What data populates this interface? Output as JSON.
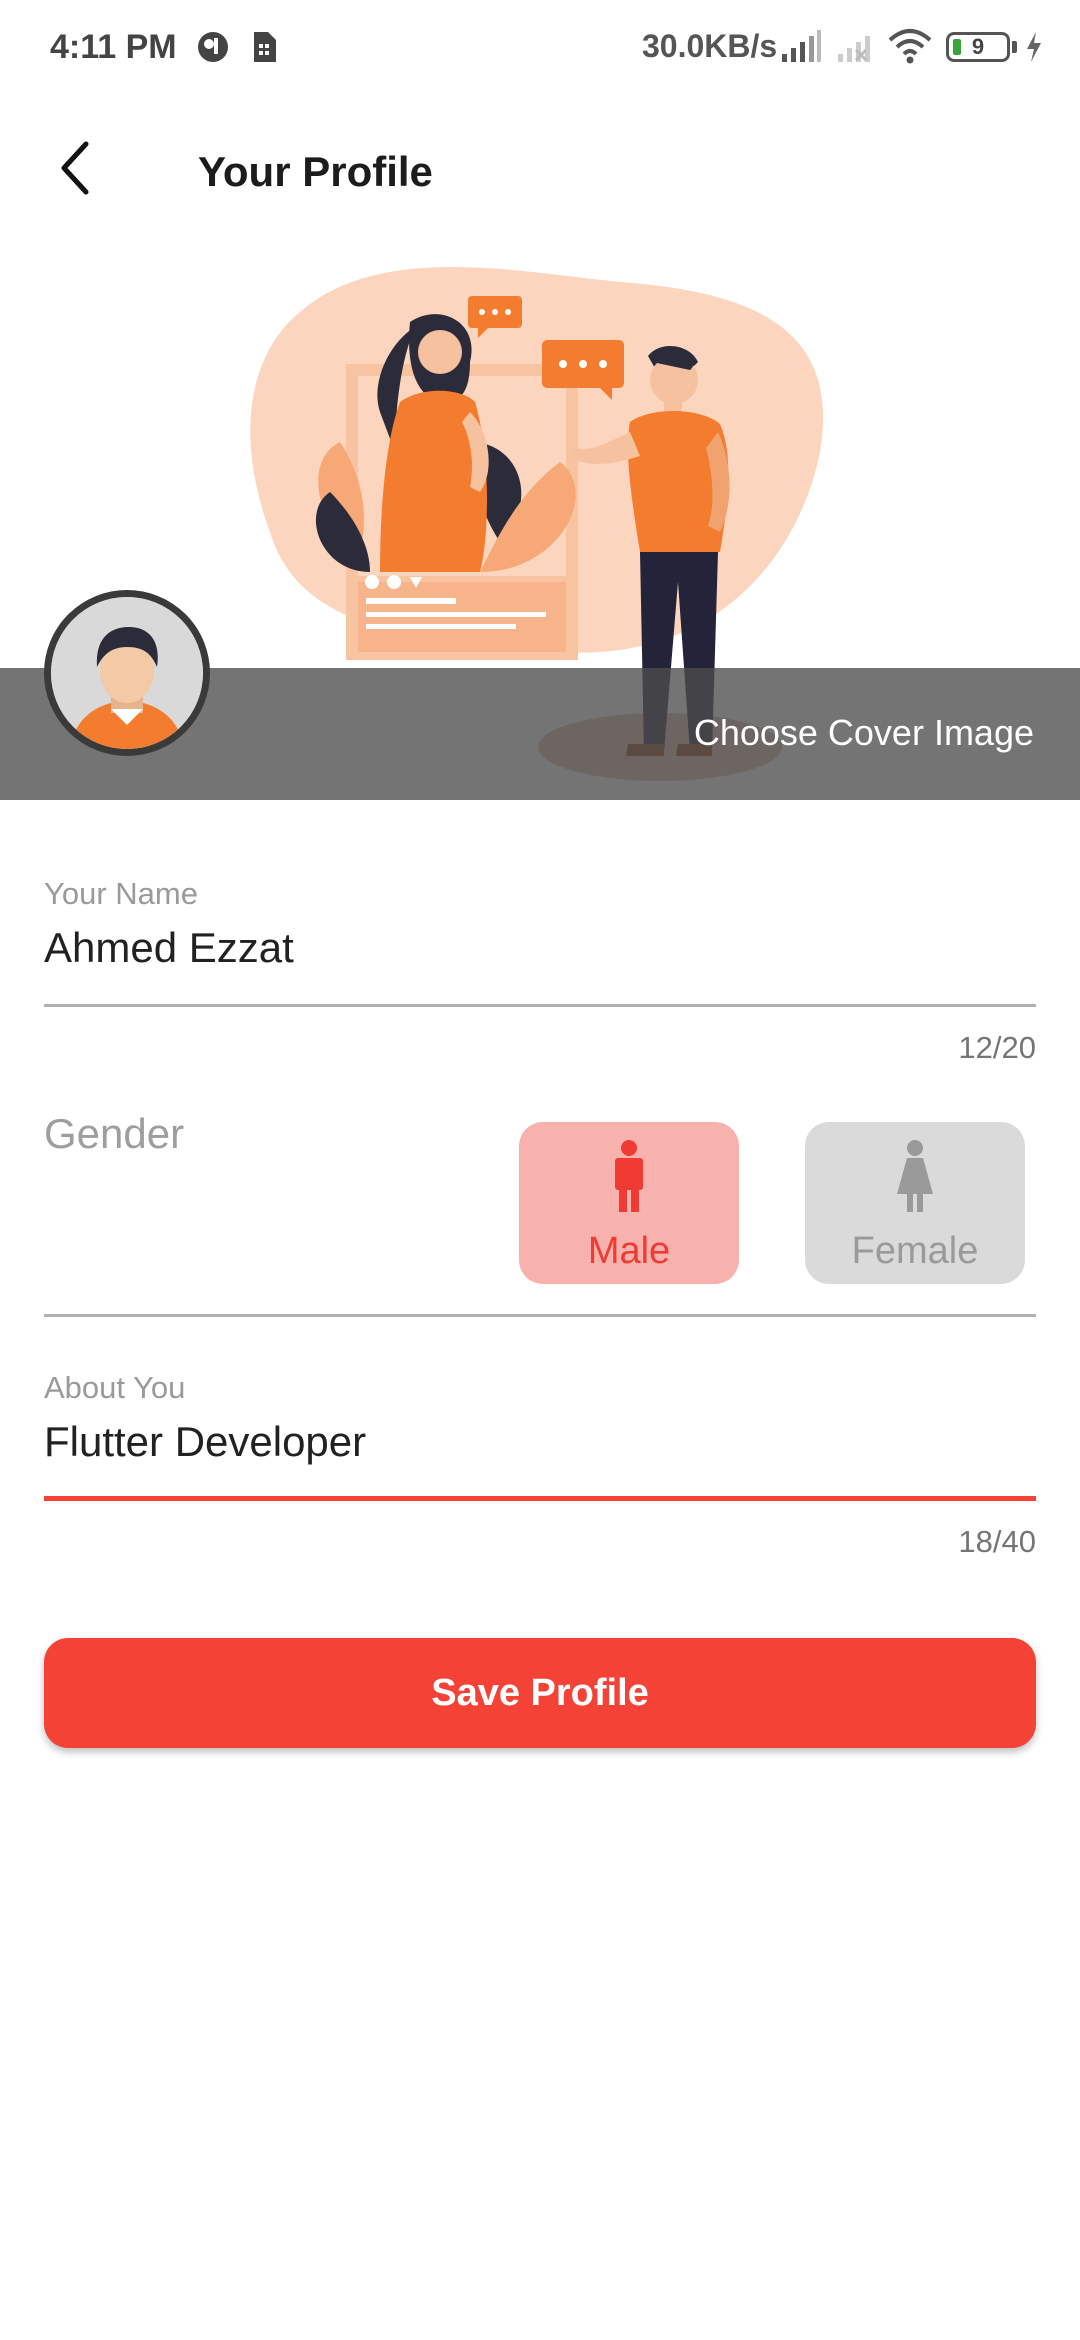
{
  "status_bar": {
    "time": "4:11 PM",
    "net_speed": "30.0KB/s",
    "battery_level": "9",
    "icons": [
      "app-icon",
      "sim-icon",
      "signal-icon",
      "signal-off-icon",
      "wifi-icon",
      "battery-icon",
      "charging-icon"
    ]
  },
  "app_bar": {
    "title": "Your Profile",
    "back_icon": "back-arrow-icon"
  },
  "cover": {
    "choose_label": "Choose Cover Image",
    "illustration": "social-media-illustration"
  },
  "form": {
    "name": {
      "label": "Your Name",
      "value": "Ahmed Ezzat",
      "counter": "12/20"
    },
    "gender": {
      "label": "Gender",
      "options": [
        {
          "label": "Male",
          "icon": "male-icon",
          "selected": true
        },
        {
          "label": "Female",
          "icon": "female-icon",
          "selected": false
        }
      ]
    },
    "about": {
      "label": "About You",
      "value": "Flutter Developer",
      "counter": "18/40"
    },
    "save_label": "Save Profile"
  },
  "colors": {
    "accent": "#f44336",
    "male_bg": "#f8b2ae",
    "female_bg": "#dadada",
    "illustration_orange": "#f37c2e",
    "illustration_peach": "#fbd5bd"
  }
}
